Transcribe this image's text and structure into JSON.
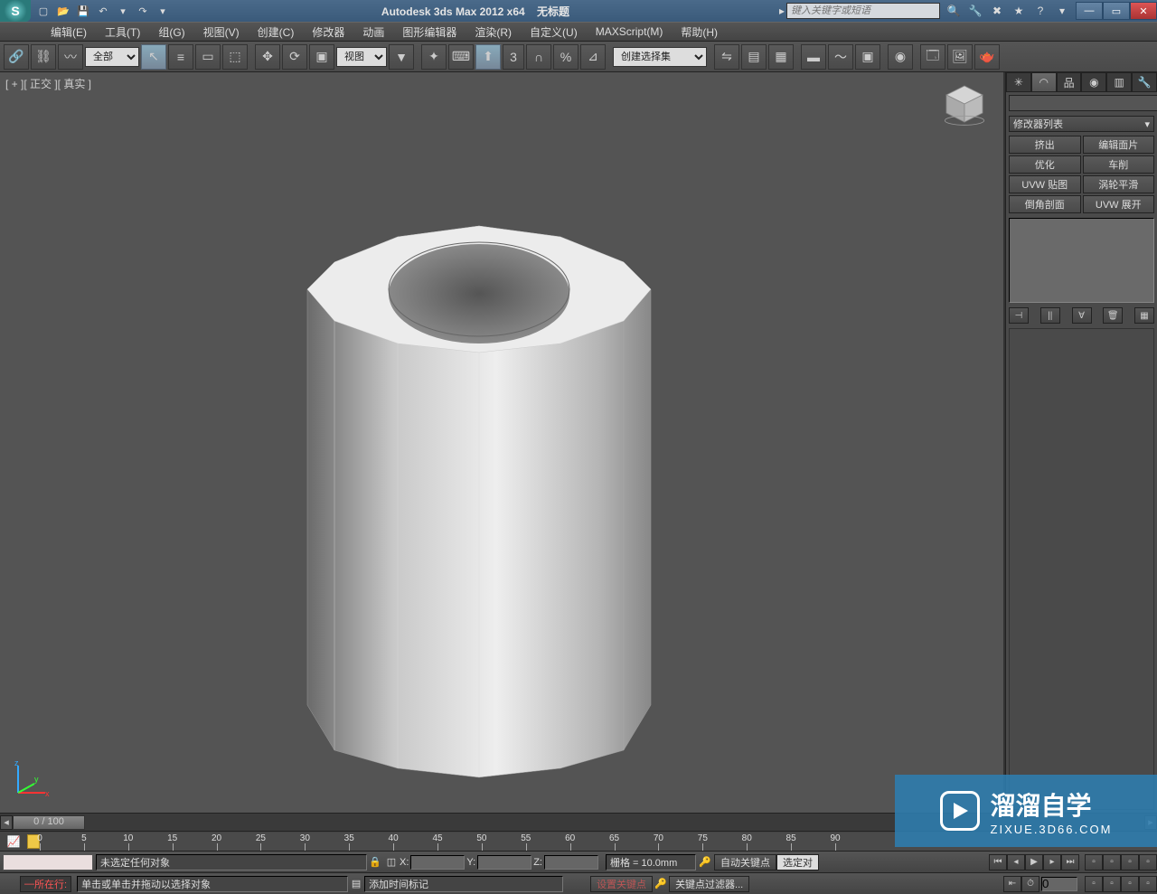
{
  "title_bar": {
    "app_title": "Autodesk 3ds Max  2012 x64",
    "doc_title": "无标题",
    "search_placeholder": "键入关键字或短语"
  },
  "menu": {
    "edit": "编辑(E)",
    "tools": "工具(T)",
    "group": "组(G)",
    "views": "视图(V)",
    "create": "创建(C)",
    "modifiers": "修改器",
    "animation": "动画",
    "graph": "图形编辑器",
    "render": "渲染(R)",
    "customize": "自定义(U)",
    "maxscript": "MAXScript(M)",
    "help": "帮助(H)"
  },
  "toolbar": {
    "filter_all": "全部",
    "view_mode": "视图",
    "sel_set": "创建选择集"
  },
  "viewport": {
    "label": "[ + ][ 正交 ][ 真实 ]"
  },
  "cmd_panel": {
    "modifier_list": "修改器列表",
    "buttons": {
      "extrude": "挤出",
      "edit_patch": "编辑面片",
      "optimize": "优化",
      "lathe": "车削",
      "uvw_map": "UVW 贴图",
      "turbosmooth": "涡轮平滑",
      "chamfer": "倒角剖面",
      "uvw_unwrap": "UVW 展开"
    }
  },
  "time": {
    "slider_label": "0 / 100",
    "ticks": [
      0,
      5,
      10,
      15,
      20,
      25,
      30,
      35,
      40,
      45,
      50,
      55,
      60,
      65,
      70,
      75,
      80,
      85,
      90
    ]
  },
  "status": {
    "no_selection": "未选定任何对象",
    "prompt": "单击或单击并拖动以选择对象",
    "x_label": "X:",
    "y_label": "Y:",
    "z_label": "Z:",
    "grid": "栅格 = 10.0mm",
    "auto_key": "自动关键点",
    "sel_obj": "选定对",
    "set_key": "设置关键点",
    "key_filter": "关键点过滤器...",
    "now": "所在行:",
    "add_time_tag": "添加时间标记",
    "frame_val": "0"
  },
  "watermark": {
    "title": "溜溜自学",
    "sub": "ZIXUE.3D66.COM"
  }
}
